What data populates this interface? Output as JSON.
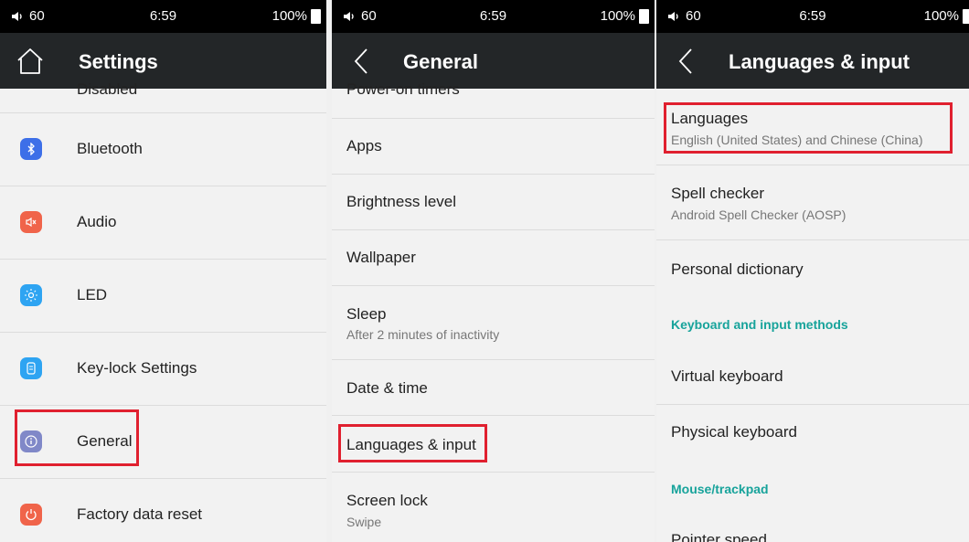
{
  "statusbar": {
    "volume": "60",
    "time": "6:59",
    "battery": "100%"
  },
  "screen1": {
    "title": "Settings",
    "items": [
      {
        "label": "Disabled"
      },
      {
        "label": "Bluetooth",
        "icon": "bluetooth-icon",
        "color": "#3d6fe8"
      },
      {
        "label": "Audio",
        "icon": "speaker-icon",
        "color": "#f0644a"
      },
      {
        "label": "LED",
        "icon": "led-icon",
        "color": "#2ea4f2"
      },
      {
        "label": "Key-lock Settings",
        "icon": "key-lock-icon",
        "color": "#2ea4f2"
      },
      {
        "label": "General",
        "icon": "info-icon",
        "color": "#8088c8"
      },
      {
        "label": "Factory data reset",
        "icon": "reset-icon",
        "color": "#f0644a"
      }
    ]
  },
  "screen2": {
    "title": "General",
    "items": [
      {
        "label": "Power-on timers"
      },
      {
        "label": "Apps"
      },
      {
        "label": "Brightness level"
      },
      {
        "label": "Wallpaper"
      },
      {
        "label": "Sleep",
        "sub": "After 2 minutes of inactivity"
      },
      {
        "label": "Date & time"
      },
      {
        "label": "Languages & input"
      },
      {
        "label": "Screen lock",
        "sub": "Swipe"
      }
    ]
  },
  "screen3": {
    "title": "Languages & input",
    "items": [
      {
        "label": "Languages",
        "sub": "English (United States) and Chinese (China)"
      },
      {
        "label": "Spell checker",
        "sub": "Android Spell Checker (AOSP)"
      },
      {
        "label": "Personal dictionary"
      },
      {
        "section": "Keyboard and input methods"
      },
      {
        "label": "Virtual keyboard"
      },
      {
        "label": "Physical keyboard"
      },
      {
        "section": "Mouse/trackpad"
      },
      {
        "label": "Pointer speed"
      }
    ]
  },
  "colors": {
    "highlight": "#e0202f",
    "accent": "#17a39b",
    "topbar": "#232628"
  }
}
